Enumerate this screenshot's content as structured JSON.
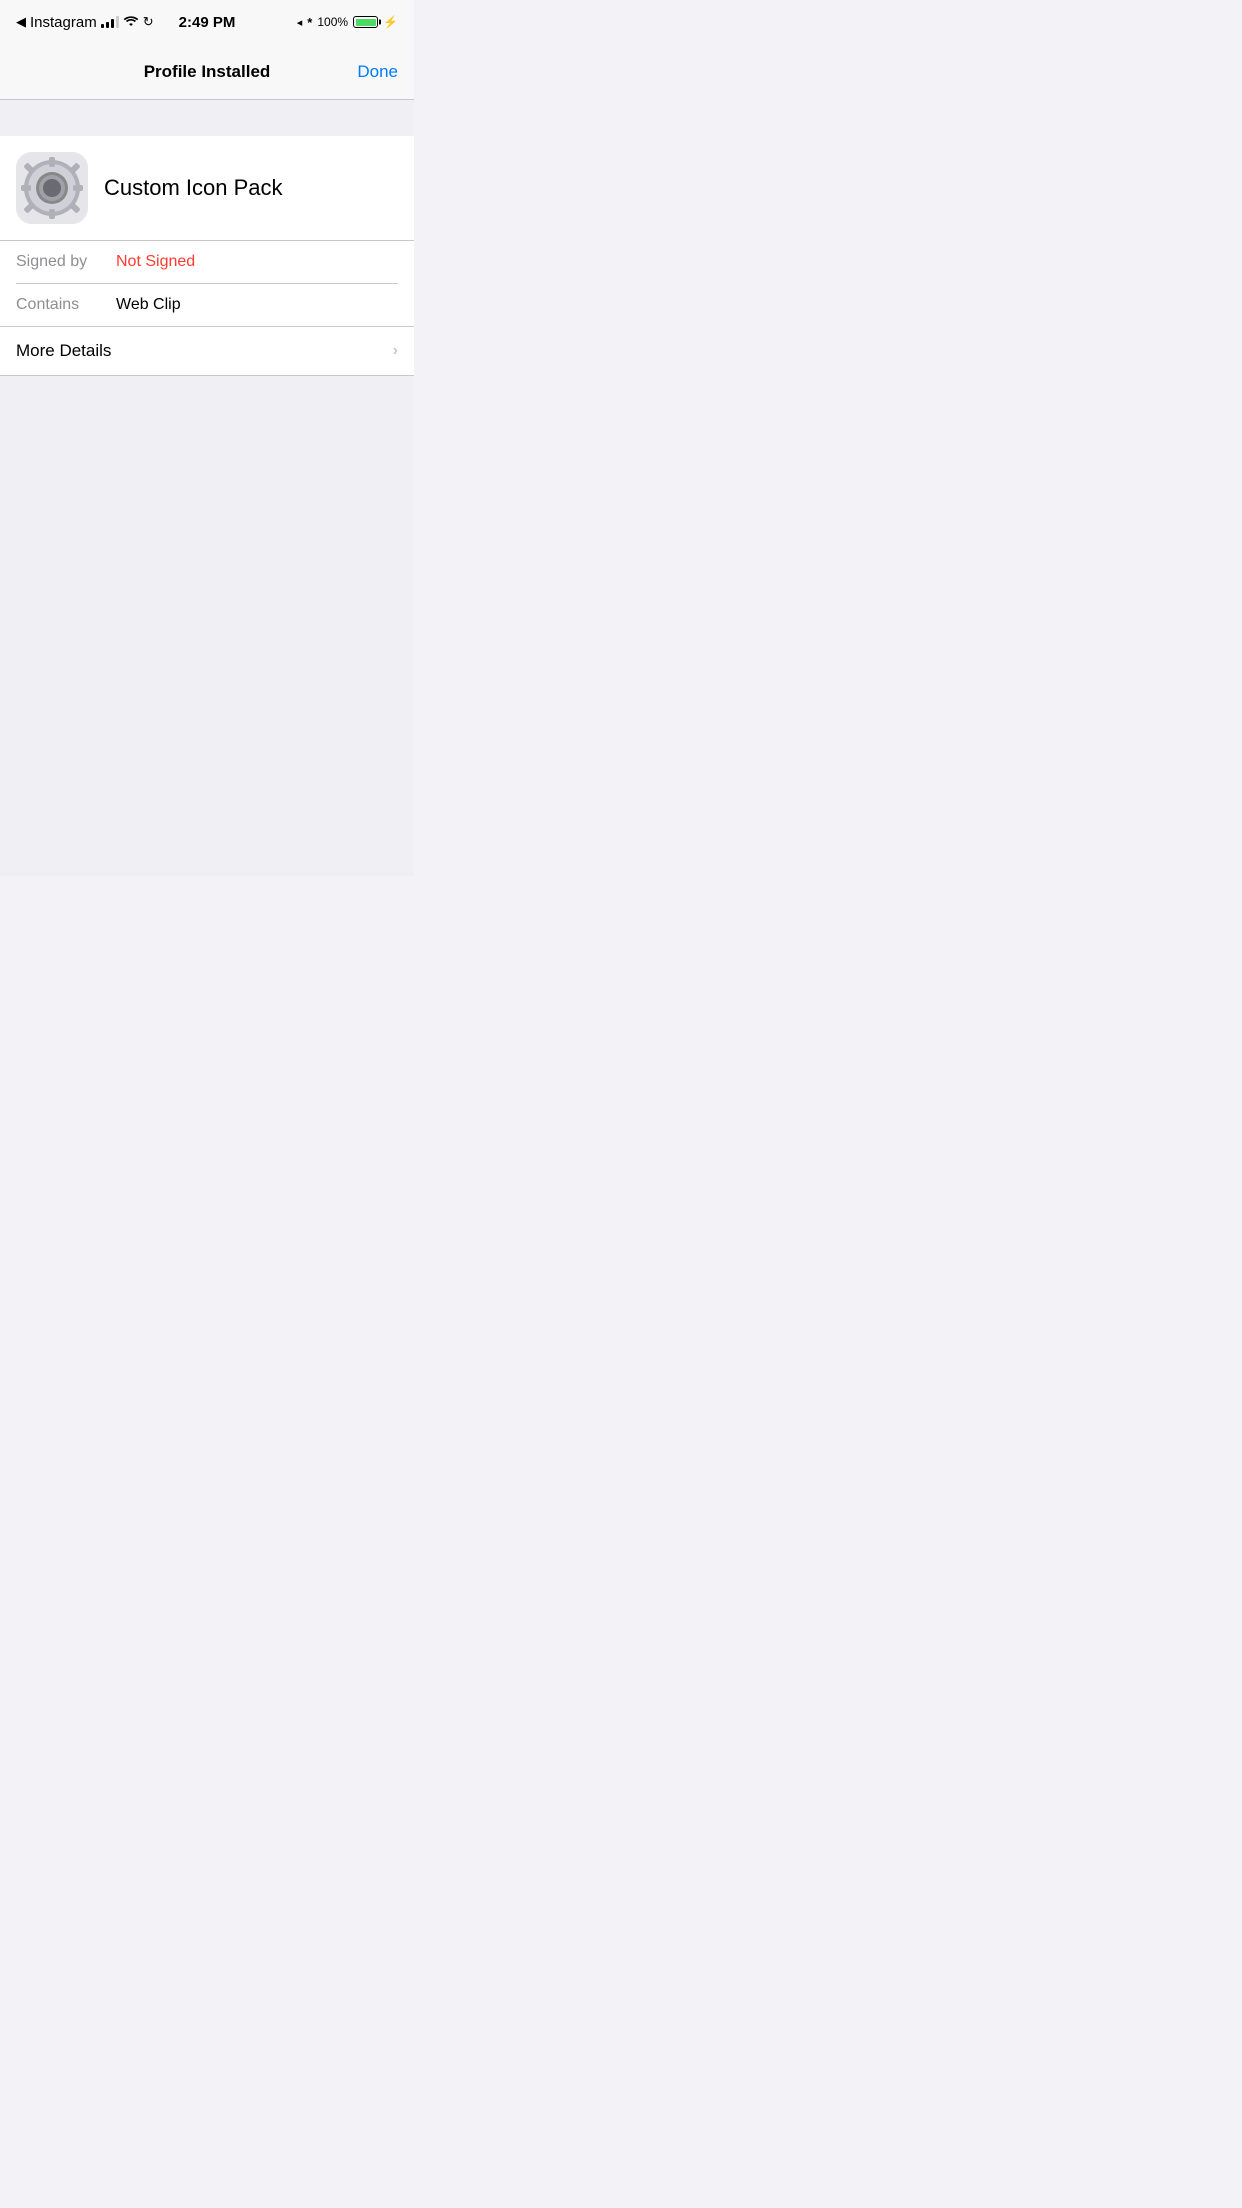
{
  "statusBar": {
    "appName": "Instagram",
    "time": "2:49 PM",
    "batteryPercent": "100%",
    "batteryFull": true
  },
  "navBar": {
    "title": "Profile Installed",
    "doneLabel": "Done"
  },
  "profile": {
    "name": "Custom Icon Pack",
    "iconAlt": "settings-gear-icon"
  },
  "details": {
    "signedByLabel": "Signed by",
    "signedByValue": "Not Signed",
    "containsLabel": "Contains",
    "containsValue": "Web Clip"
  },
  "moreDetails": {
    "label": "More Details"
  }
}
